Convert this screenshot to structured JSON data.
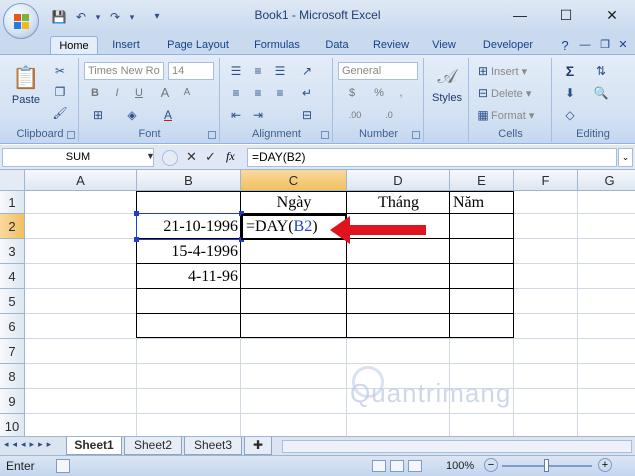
{
  "app": {
    "title": "Book1 - Microsoft Excel",
    "window_controls": {
      "minimize": "—",
      "maximize": "☐",
      "close": "✕"
    }
  },
  "quick_access": {
    "save_icon": "💾",
    "undo_icon": "↶",
    "redo_icon": "↷",
    "customize_icon": "▾"
  },
  "tabs": [
    "Home",
    "Insert",
    "Page Layout",
    "Formulas",
    "Data",
    "Review",
    "View",
    "Developer"
  ],
  "ribbon": {
    "clipboard": {
      "label": "Clipboard",
      "paste": "Paste"
    },
    "font": {
      "label": "Font",
      "font_name": "Times New Ro",
      "font_size": "14",
      "bold": "B",
      "italic": "I",
      "underline": "U",
      "grow": "A",
      "shrink": "A"
    },
    "alignment": {
      "label": "Alignment"
    },
    "number": {
      "label": "Number",
      "format": "General",
      "currency": "$",
      "percent": "%",
      "comma": ",",
      "inc_dec": ".00",
      "dec_dec": ".0"
    },
    "styles": {
      "label": "Styles"
    },
    "cells": {
      "label": "Cells",
      "insert": "Insert",
      "delete": "Delete",
      "format": "Format"
    },
    "editing": {
      "label": "Editing",
      "sum": "Σ"
    }
  },
  "formula_bar": {
    "name_box": "SUM",
    "fx": "fx",
    "formula": "=DAY(B2)"
  },
  "columns": [
    "A",
    "B",
    "C",
    "D",
    "E",
    "F",
    "G"
  ],
  "rows": [
    "1",
    "2",
    "3",
    "4",
    "5",
    "6",
    "7",
    "8",
    "9",
    "10"
  ],
  "cells": {
    "C1": "Ngày",
    "D1": "Tháng",
    "E1": "Năm",
    "B2": "21-10-1996",
    "B3": "15-4-1996",
    "B4": "4-11-96",
    "C2_prefix": "=DAY(",
    "C2_ref": "B2",
    "C2_suffix": ")"
  },
  "sheets": [
    "Sheet1",
    "Sheet2",
    "Sheet3"
  ],
  "status": {
    "mode": "Enter",
    "zoom": "100%"
  },
  "watermark": "Quantrimang",
  "colors": {
    "accent": "#15428b",
    "arrow": "#e0141e",
    "ref_blue": "#1f3ed1"
  }
}
